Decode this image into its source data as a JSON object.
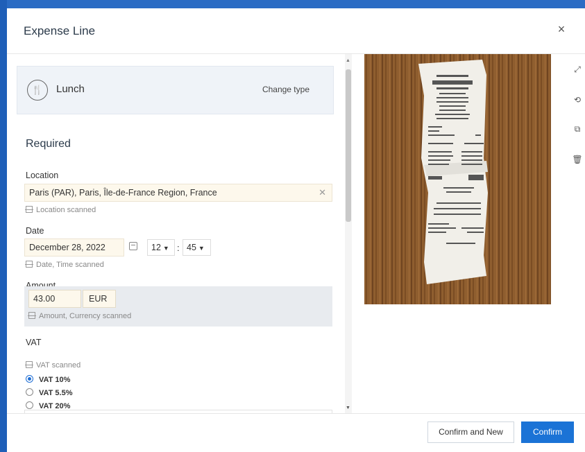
{
  "modal": {
    "title": "Expense Line",
    "close_glyph": "×"
  },
  "type_card": {
    "icon": "fork-knife-icon",
    "label": "Lunch",
    "change_type": "Change type"
  },
  "form": {
    "section_title": "Required",
    "location": {
      "label": "Location",
      "value": "Paris (PAR), Paris, Île-de-France Region, France",
      "scanned": "Location scanned"
    },
    "date": {
      "label": "Date",
      "value": "December 28, 2022",
      "hour": "12",
      "minute": "45",
      "separator": ":",
      "scanned": "Date, Time scanned"
    },
    "amount": {
      "label": "Amount",
      "value": "43.00",
      "currency": "EUR",
      "scanned": "Amount, Currency scanned"
    },
    "vat": {
      "label": "VAT",
      "scanned": "VAT scanned",
      "options": [
        {
          "label": "VAT 10%",
          "selected": true
        },
        {
          "label": "VAT 5.5%",
          "selected": false
        },
        {
          "label": "VAT 20%",
          "selected": false
        }
      ]
    }
  },
  "image_tools": [
    "expand-icon",
    "rotate-icon",
    "copy-icon",
    "trash-icon"
  ],
  "footer": {
    "confirm_new": "Confirm and New",
    "confirm": "Confirm"
  },
  "colors": {
    "primary": "#1b73d6",
    "input_bg": "#fdf8ec",
    "backdrop": "#1f5fb8"
  }
}
